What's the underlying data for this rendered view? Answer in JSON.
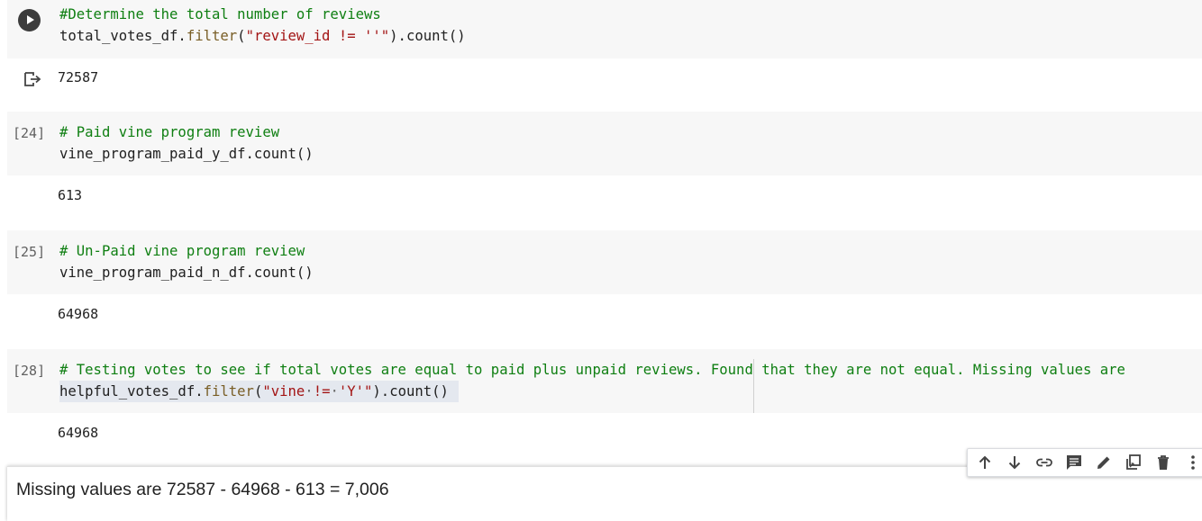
{
  "cells": [
    {
      "exec_count": "",
      "code_line1_comment": "#Determine the total number of reviews",
      "code_line2_a": "total_votes_df.",
      "code_line2_fn": "filter",
      "code_line2_b": "(",
      "code_line2_str": "\"review_id != ''\"",
      "code_line2_c": ").count()",
      "output": "72587"
    },
    {
      "exec_count": "[24]",
      "code_line1_comment": "# Paid vine program review",
      "code_line2": "vine_program_paid_y_df.count()",
      "output": "613"
    },
    {
      "exec_count": "[25]",
      "code_line1_comment": "# Un-Paid vine program review",
      "code_line2": "vine_program_paid_n_df.count()",
      "output": "64968"
    },
    {
      "exec_count": "[28]",
      "code_line1_comment": "# Testing votes to see if total votes are equal to paid plus unpaid reviews. Found that they are not equal. Missing values are",
      "code_line2_a": "helpful_votes_df.",
      "code_line2_fn": "filter",
      "code_line2_b": "(",
      "code_line2_str_a": "\"vine",
      "code_line2_dot1": "·",
      "code_line2_str_b": "!=",
      "code_line2_dot2": "·",
      "code_line2_str_c": "'Y'\"",
      "code_line2_c": ").count()",
      "output": "64968"
    }
  ],
  "text_cell": {
    "text": "Missing values are 72587 - 64968 - 613 = 7,006"
  },
  "toolbar": {
    "buttons": [
      "arrow-up-icon",
      "arrow-down-icon",
      "link-icon",
      "comment-icon",
      "edit-icon",
      "mirror-cell-icon",
      "delete-icon",
      "more-icon"
    ]
  }
}
